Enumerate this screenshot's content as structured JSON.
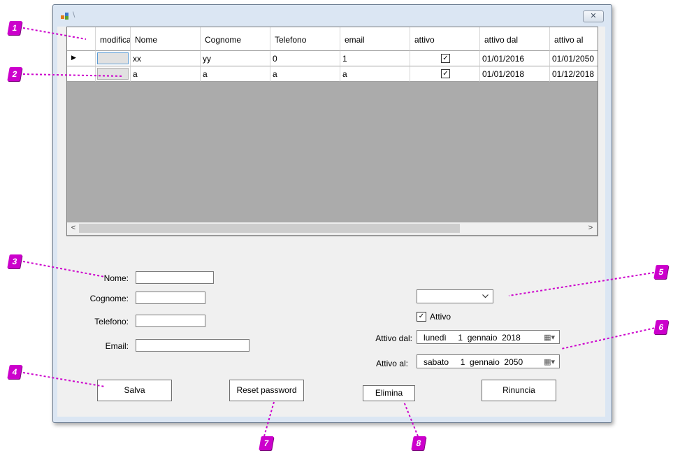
{
  "window": {
    "title": "\\",
    "close_glyph": "✕"
  },
  "grid": {
    "columns": [
      "",
      "modifica",
      "Nome",
      "Cognome",
      "Telefono",
      "email",
      "attivo",
      "attivo dal",
      "attivo al"
    ],
    "rows": [
      {
        "current": true,
        "nome": "xx",
        "cognome": "yy",
        "telefono": "0",
        "email": "1",
        "attivo": true,
        "attivo_dal": "01/01/2016",
        "attivo_al": "01/01/2050"
      },
      {
        "current": false,
        "nome": "a",
        "cognome": "a",
        "telefono": "a",
        "email": "a",
        "attivo": true,
        "attivo_dal": "01/01/2018",
        "attivo_al": "01/12/2018"
      }
    ],
    "scroll_left_glyph": "<",
    "scroll_right_glyph": ">"
  },
  "form": {
    "nome_label": "Nome:",
    "cognome_label": "Cognome:",
    "telefono_label": "Telefono:",
    "email_label": "Email:",
    "nome_value": "",
    "cognome_value": "",
    "telefono_value": "",
    "email_value": "",
    "combo_value": "",
    "attivo_label": "Attivo",
    "attivo_checked": true,
    "attivo_dal_label": "Attivo dal:",
    "attivo_al_label": "Attivo al:",
    "attivo_dal_value": "lunedì     1  gennaio  2018",
    "attivo_al_value": "sabato     1  gennaio  2050"
  },
  "buttons": {
    "salva": "Salva",
    "reset_password": "Reset password",
    "elimina": "Elimina",
    "rinuncia": "Rinuncia"
  },
  "callouts": [
    "1",
    "2",
    "3",
    "4",
    "5",
    "6",
    "7",
    "8"
  ],
  "colors": {
    "callout": "#cc00cc",
    "leader": "#cc00cc",
    "grid_background": "#ababab",
    "form_background": "#f0f0f0"
  }
}
